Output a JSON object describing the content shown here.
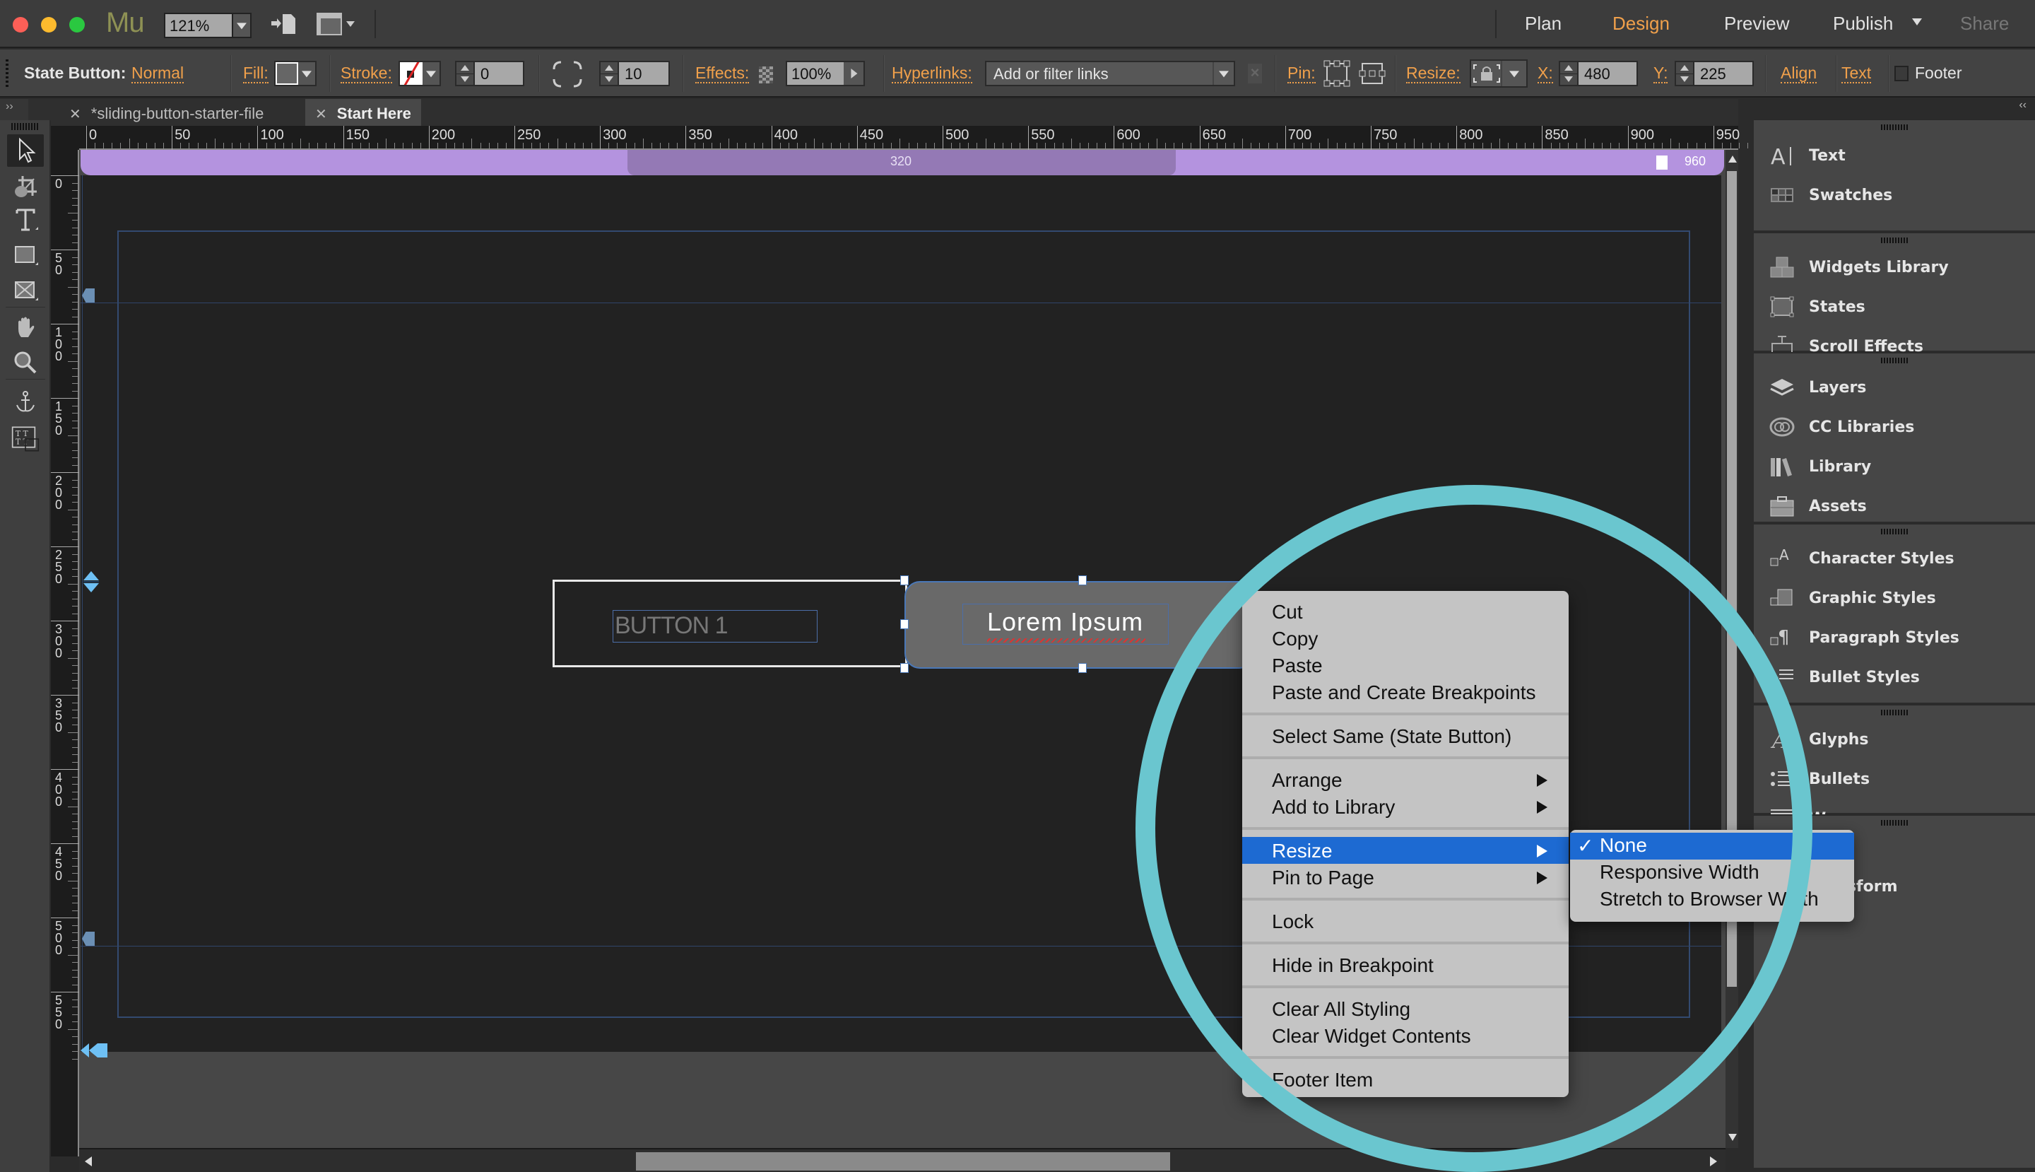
{
  "app": {
    "logo": "Mu",
    "zoom": "121%",
    "modes": [
      {
        "label": "Plan",
        "state": "normal"
      },
      {
        "label": "Design",
        "state": "active"
      },
      {
        "label": "Preview",
        "state": "normal"
      },
      {
        "label": "Publish",
        "state": "normal"
      },
      {
        "label": "Share",
        "state": "disabled"
      }
    ]
  },
  "controlbar": {
    "object_type": "State Button:",
    "state": "Normal",
    "fill_label": "Fill:",
    "stroke_label": "Stroke:",
    "stroke_width": "0",
    "corner_radius": "10",
    "effects_label": "Effects:",
    "opacity": "100%",
    "hyperlinks_label": "Hyperlinks:",
    "hyperlinks_placeholder": "Add or filter links",
    "hyperlinks_clear": "×",
    "pin_label": "Pin:",
    "resize_label": "Resize:",
    "x_label": "X:",
    "x_value": "480",
    "y_label": "Y:",
    "y_value": "225",
    "align_label": "Align",
    "text_label": "Text",
    "footer_label": "Footer",
    "footer_checked": false
  },
  "tabs": [
    {
      "label": "*sliding-button-starter-file",
      "active": false
    },
    {
      "label": "Start Here",
      "active": true
    }
  ],
  "tools": [
    {
      "name": "selection-tool",
      "active": true
    },
    {
      "name": "crop-tool",
      "active": false
    },
    {
      "name": "text-tool",
      "active": false
    },
    {
      "name": "rectangle-tool",
      "active": false
    },
    {
      "name": "image-frame-tool",
      "active": false
    },
    {
      "name": "hand-tool",
      "active": false
    },
    {
      "name": "zoom-tool",
      "active": false
    },
    {
      "name": "anchor-tool",
      "active": false
    },
    {
      "name": "text-frame-tool",
      "active": false
    }
  ],
  "ruler": {
    "horizontal": [
      "0",
      "50",
      "100",
      "150",
      "200",
      "250",
      "300",
      "350",
      "400",
      "450",
      "500",
      "550",
      "600",
      "650",
      "700",
      "750",
      "800",
      "850",
      "900",
      "950"
    ],
    "vertical": [
      "0",
      "50",
      "100",
      "150",
      "200",
      "250",
      "300",
      "350",
      "400",
      "450",
      "500",
      "550"
    ]
  },
  "breakpoints": {
    "min": "320",
    "max": "960"
  },
  "canvas": {
    "button1_text": "BUTTON 1",
    "button2_text": "Lorem Ipsum"
  },
  "context_menu": {
    "groups": [
      [
        {
          "label": "Cut"
        },
        {
          "label": "Copy"
        },
        {
          "label": "Paste"
        },
        {
          "label": "Paste and Create Breakpoints"
        }
      ],
      [
        {
          "label": "Select Same (State Button)"
        }
      ],
      [
        {
          "label": "Arrange",
          "submenu": true
        },
        {
          "label": "Add to Library",
          "submenu": true
        }
      ],
      [
        {
          "label": "Resize",
          "submenu": true,
          "highlight": true
        },
        {
          "label": "Pin to Page",
          "submenu": true
        }
      ],
      [
        {
          "label": "Lock"
        }
      ],
      [
        {
          "label": "Hide in Breakpoint"
        }
      ],
      [
        {
          "label": "Clear All Styling"
        },
        {
          "label": "Clear Widget Contents"
        }
      ],
      [
        {
          "label": "Footer Item"
        }
      ]
    ],
    "resize_submenu": [
      {
        "label": "None",
        "checked": true,
        "highlight": true
      },
      {
        "label": "Responsive Width",
        "checked": false
      },
      {
        "label": "Stretch to Browser Width",
        "checked": false
      }
    ],
    "checkmark": "✓"
  },
  "panels": {
    "groups": [
      [
        {
          "label": "Text",
          "icon": "text-panel-icon"
        },
        {
          "label": "Swatches",
          "icon": "swatches-icon"
        }
      ],
      [
        {
          "label": "Widgets Library",
          "icon": "widgets-library-icon"
        },
        {
          "label": "States",
          "icon": "states-icon"
        },
        {
          "label": "Scroll Effects",
          "icon": "scroll-effects-icon"
        }
      ],
      [
        {
          "label": "Layers",
          "icon": "layers-icon"
        },
        {
          "label": "CC Libraries",
          "icon": "cc-libraries-icon"
        },
        {
          "label": "Library",
          "icon": "library-icon"
        },
        {
          "label": "Assets",
          "icon": "assets-icon"
        }
      ],
      [
        {
          "label": "Character Styles",
          "icon": "character-styles-icon"
        },
        {
          "label": "Graphic Styles",
          "icon": "graphic-styles-icon"
        },
        {
          "label": "Paragraph Styles",
          "icon": "paragraph-styles-icon"
        },
        {
          "label": "Bullet Styles",
          "icon": "bullet-styles-icon"
        }
      ],
      [
        {
          "label": "Glyphs",
          "icon": "glyphs-icon"
        },
        {
          "label": "Bullets",
          "icon": "bullets-icon"
        },
        {
          "label": "Wrap",
          "icon": "wrap-icon"
        }
      ],
      [
        {
          "label": "",
          "icon": "panel-icon"
        },
        {
          "label": "Transform",
          "icon": "transform-icon"
        }
      ]
    ]
  },
  "colors": {
    "accent_orange": "#f0a04b",
    "breakpoint_purple": "#b493df",
    "menu_highlight": "#1d6ad2",
    "annotation_teal": "#6ac6cf"
  }
}
